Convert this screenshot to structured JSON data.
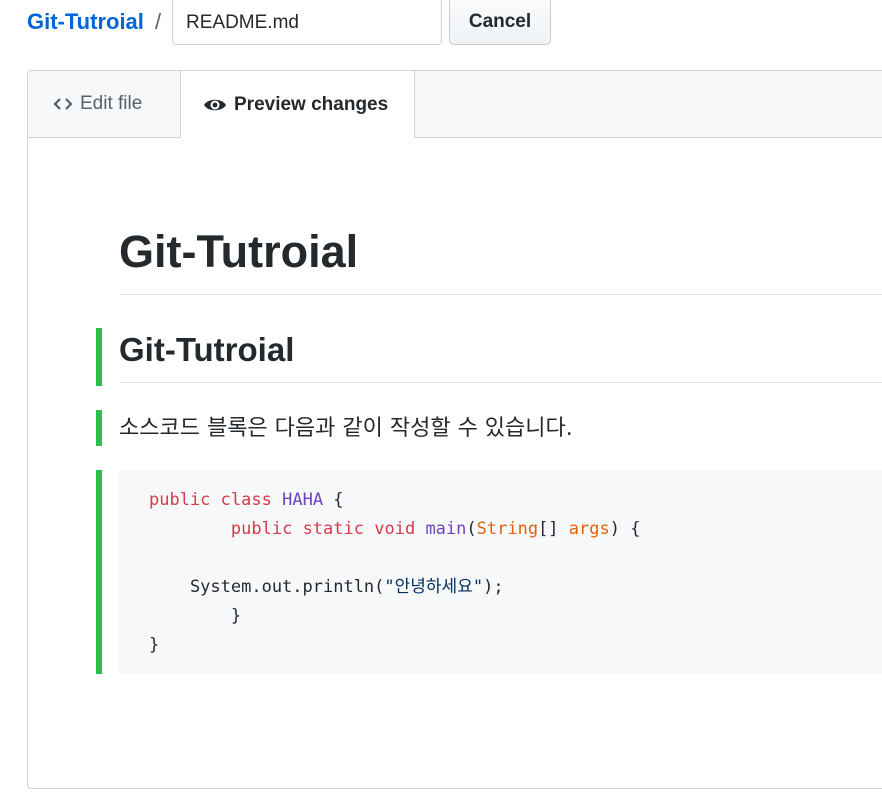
{
  "header": {
    "repo_name": "Git-Tutroial",
    "separator": "/",
    "filename_value": "README.md",
    "cancel_label": "Cancel"
  },
  "tabs": {
    "edit_label": "Edit file",
    "preview_label": "Preview changes",
    "active": "Preview changes"
  },
  "preview": {
    "h1": "Git-Tutroial",
    "h2": "Git-Tutroial",
    "paragraph": "소스코드 블록은 다음과 같이 작성할 수 있습니다.",
    "code": {
      "language": "java",
      "lines": [
        "public class HAHA {",
        "        public static void main(String[] args) {",
        "",
        "    System.out.println(\"안녕하세요\");",
        "        }",
        "}"
      ]
    }
  },
  "colors": {
    "link": "#0366d6",
    "diff_added": "#2cbe4e",
    "code_bg": "#f6f8fa",
    "keyword": "#d73a49",
    "class_name": "#6f42c1",
    "type": "#e36209",
    "string": "#032f62"
  },
  "icons": {
    "edit_tab_icon": "code-icon",
    "preview_tab_icon": "eye-icon"
  }
}
